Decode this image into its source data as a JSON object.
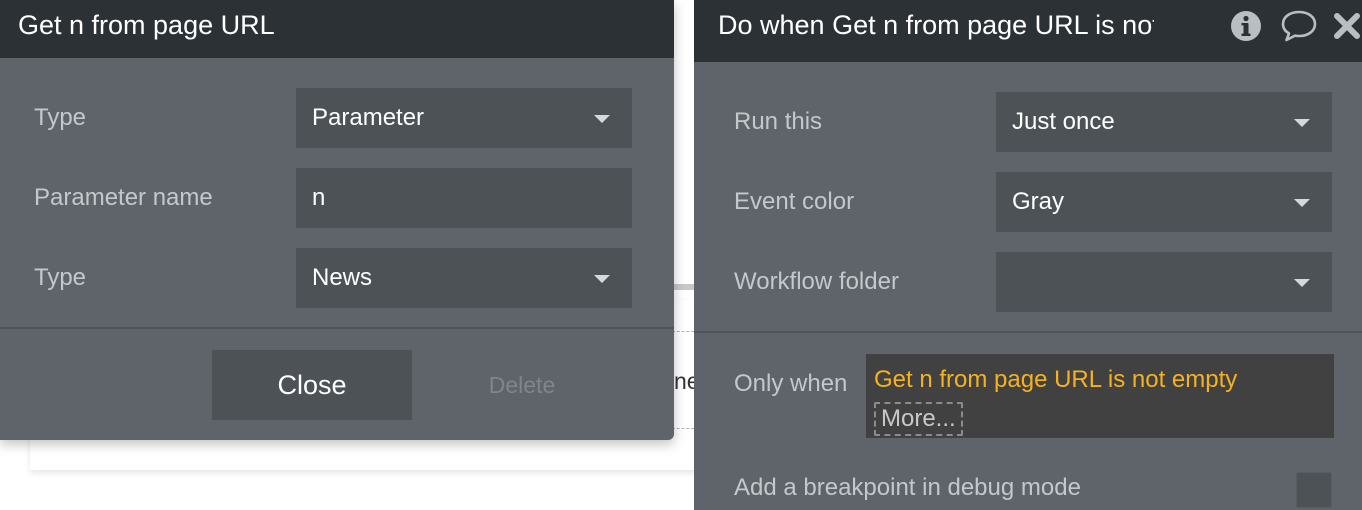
{
  "param_popup": {
    "title": "Get n from page URL",
    "rows": [
      {
        "label": "Type",
        "value": "Parameter"
      },
      {
        "label": "Parameter name",
        "value": "n"
      },
      {
        "label": "Type",
        "value": "News"
      }
    ],
    "close_label": "Close",
    "delete_label": "Delete"
  },
  "event_panel": {
    "title": "Do when Get n from page URL is not empty",
    "rows": [
      {
        "label": "Run this",
        "value": "Just once"
      },
      {
        "label": "Event color",
        "value": "Gray"
      },
      {
        "label": "Workflow folder",
        "value": ""
      }
    ],
    "only_when_label": "Only when",
    "condition_text": "Get n from page URL is not empty",
    "more_label": "More...",
    "breakpoint_label": "Add a breakpoint in debug mode"
  },
  "background": {
    "peek_text": "ne"
  },
  "colors": {
    "panel_bg": "#5e6469",
    "header_bg": "#2b3134",
    "field_bg": "#4c5256",
    "condition_text": "#f5b21e",
    "condition_bg": "#414141"
  },
  "icons": [
    "info-icon",
    "comment-icon",
    "close-icon",
    "chevron-down-icon"
  ]
}
